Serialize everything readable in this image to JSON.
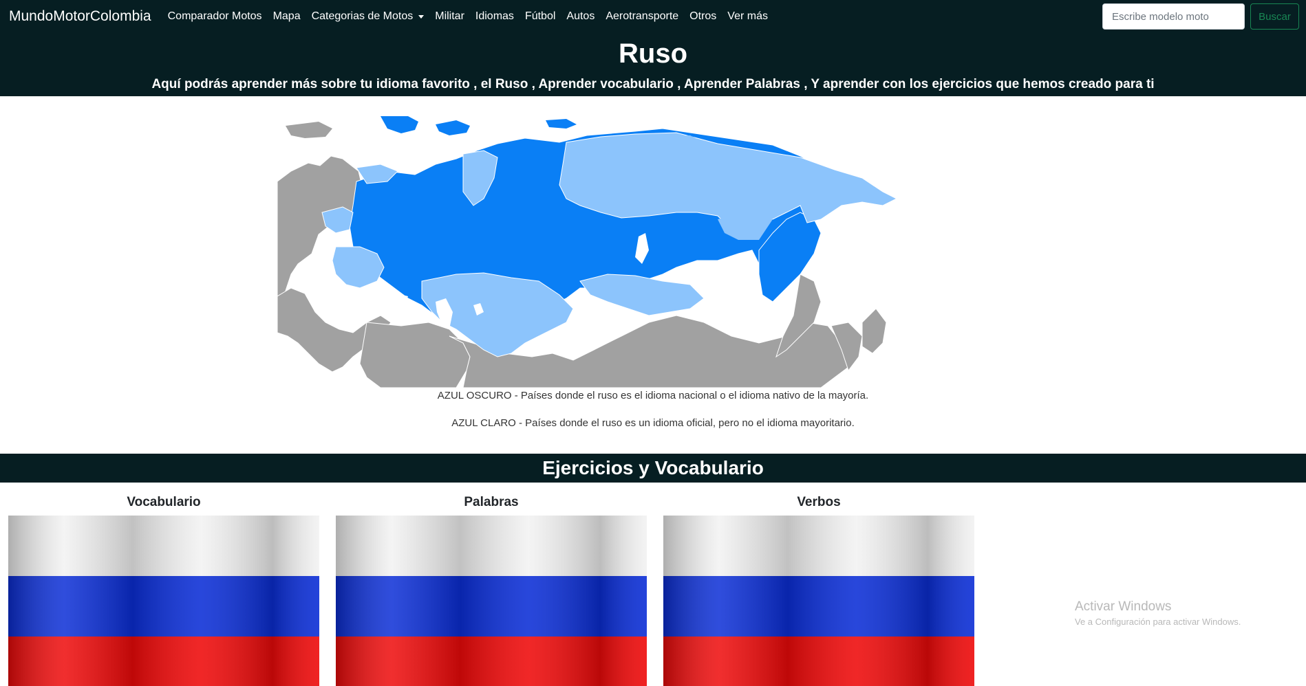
{
  "navbar": {
    "brand": "MundoMotorColombia",
    "items": [
      {
        "label": "Comparador Motos"
      },
      {
        "label": "Mapa"
      },
      {
        "label": "Categorias de Motos",
        "dropdown": true
      },
      {
        "label": "Militar"
      },
      {
        "label": "Idiomas"
      },
      {
        "label": "Fútbol"
      },
      {
        "label": "Autos"
      },
      {
        "label": "Aerotransporte"
      },
      {
        "label": "Otros"
      },
      {
        "label": "Ver más"
      }
    ],
    "search": {
      "placeholder": "Escribe modelo moto",
      "button_label": "Buscar"
    }
  },
  "hero": {
    "title": "Ruso",
    "subtitle": "Aquí podrás aprender más sobre tu idioma favorito , el Ruso , Aprender vocabulario , Aprender Palabras , Y aprender con los ejercicios que hemos creado para ti"
  },
  "map": {
    "legend_dark": "AZUL OSCURO - Países donde el ruso es el idioma nacional o el idioma nativo de la mayoría.",
    "legend_light": "AZUL CLARO - Países donde el ruso es un idioma oficial, pero no el idioma mayoritario.",
    "colors": {
      "dark": "#0a7ff5",
      "light": "#8cc4fc",
      "other": "#a1a1a1"
    }
  },
  "section": {
    "title": "Ejercicios y Vocabulario"
  },
  "cards": [
    {
      "title": "Vocabulario",
      "image": "russian-flag"
    },
    {
      "title": "Palabras",
      "image": "russian-flag"
    },
    {
      "title": "Verbos",
      "image": "russian-flag"
    }
  ],
  "watermark": {
    "line1": "Activar Windows",
    "line2": "Ve a Configuración para activar Windows."
  },
  "colors": {
    "header_bg": "#061e22",
    "search_button": "#198754"
  }
}
